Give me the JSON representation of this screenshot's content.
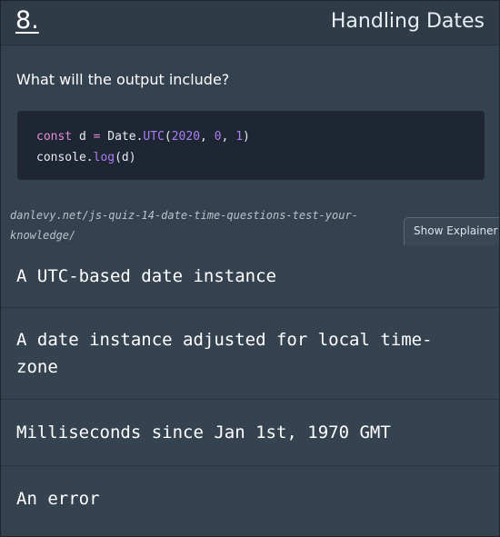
{
  "header": {
    "number": "8.",
    "title": "Handling Dates"
  },
  "question": "What will the output include?",
  "code": {
    "line1": {
      "kw": "const",
      "rest1": " d ",
      "op": "=",
      "rest2": " Date.",
      "fn": "UTC",
      "p1": "(",
      "n1": "2020",
      "c1": ", ",
      "n2": "0",
      "c2": ", ",
      "n3": "1",
      "p2": ")"
    },
    "line2": {
      "pre": "console.",
      "fn": "log",
      "post": "(d)"
    }
  },
  "source_link": "danlevy.net/js-quiz-14-date-time-questions-test-your-knowledge/",
  "explainer_button": "Show Explainer",
  "answers": [
    "A UTC-based date instance",
    "A date instance adjusted for local time-zone",
    "Milliseconds since Jan 1st, 1970 GMT",
    "An error"
  ],
  "colors": {
    "keyword": "#e58bd9",
    "function": "#a97ff2",
    "number": "#a97ff2",
    "background": "#34414e"
  }
}
